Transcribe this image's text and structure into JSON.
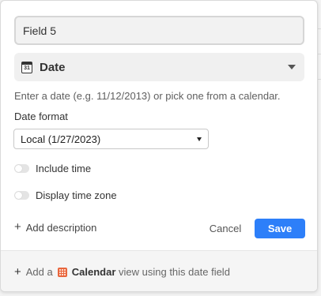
{
  "field_name": {
    "value": "Field 5"
  },
  "field_type": {
    "label": "Date",
    "icon": "calendar-icon",
    "icon_text": "31"
  },
  "help_text": "Enter a date (e.g. 11/12/2013) or pick one from a calendar.",
  "date_format": {
    "label": "Date format",
    "selected": "Local (1/27/2023)"
  },
  "toggles": [
    {
      "label": "Include time",
      "on": false
    },
    {
      "label": "Display time zone",
      "on": false
    }
  ],
  "add_description": {
    "label": "Add description"
  },
  "actions": {
    "cancel_label": "Cancel",
    "save_label": "Save"
  },
  "footer": {
    "prefix": "Add a",
    "view_name": "Calendar",
    "suffix": "view using this date field",
    "icon": "calendar-grid-icon"
  },
  "colors": {
    "accent": "#2d7ff9",
    "calendar_icon": "#e8663d"
  }
}
